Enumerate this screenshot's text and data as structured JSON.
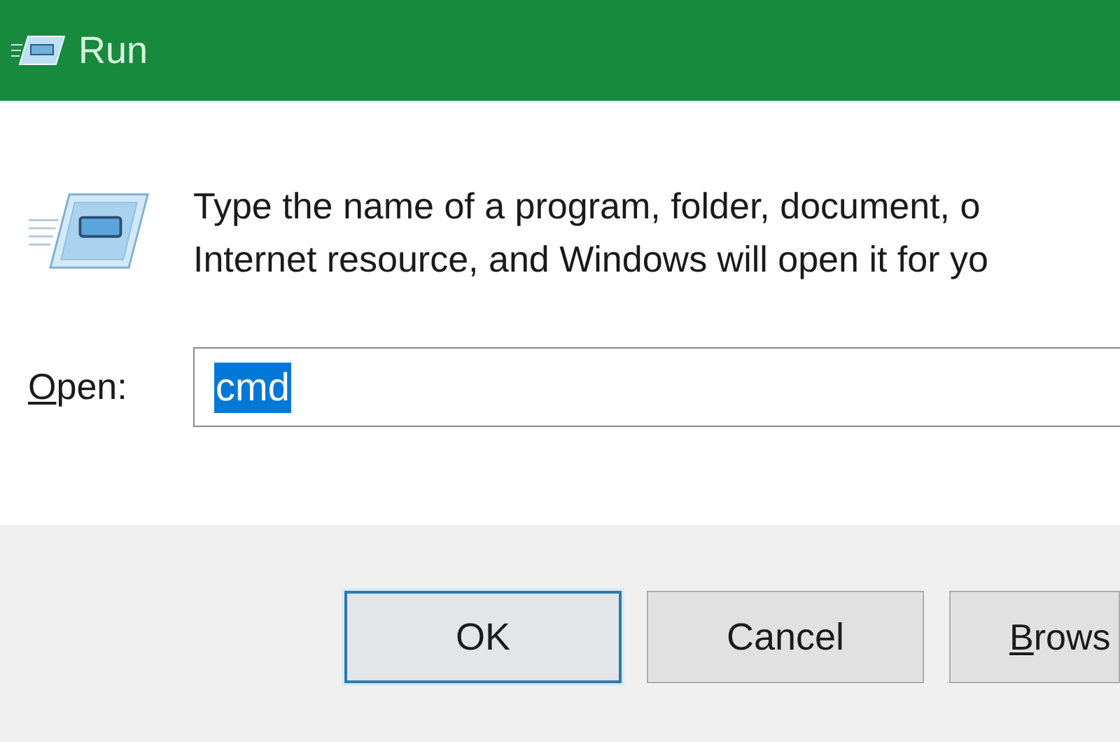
{
  "window": {
    "title": "Run"
  },
  "description": [
    "Type the name of a program, folder, document, o",
    "Internet resource, and Windows will open it for yo"
  ],
  "open_field": {
    "label": "Open:",
    "access_key": true,
    "value": "cmd",
    "selected": true
  },
  "buttons": [
    {
      "label": "OK",
      "default": true,
      "access_key": false
    },
    {
      "label": "Cancel",
      "default": false,
      "access_key": false
    },
    {
      "label": "Brows",
      "default": false,
      "access_key": true
    }
  ]
}
